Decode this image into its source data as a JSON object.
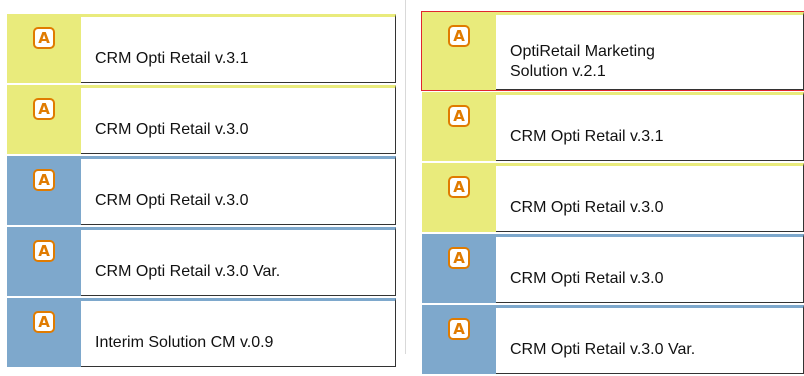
{
  "left_column": [
    {
      "label": "CRM Opti Retail v.3.1",
      "color": "yellow",
      "icon": "app-a-icon"
    },
    {
      "label": "CRM Opti Retail v.3.0",
      "color": "yellow",
      "icon": "app-a-icon"
    },
    {
      "label": "CRM Opti Retail v.3.0",
      "color": "blue",
      "icon": "app-a-icon"
    },
    {
      "label": "CRM Opti Retail v.3.0 Var.",
      "color": "blue",
      "icon": "app-a-icon"
    },
    {
      "label": "Interim Solution CM v.0.9",
      "color": "blue",
      "icon": "app-a-icon"
    }
  ],
  "right_column": [
    {
      "label_line1": "OptiRetail Marketing",
      "label_line2": "Solution v.2.1",
      "color": "yellow",
      "icon": "app-a-icon",
      "selected": true
    },
    {
      "label": "CRM Opti Retail v.3.1",
      "color": "yellow",
      "icon": "app-a-icon"
    },
    {
      "label": "CRM Opti Retail v.3.0",
      "color": "yellow",
      "icon": "app-a-icon"
    },
    {
      "label": "CRM Opti Retail v.3.0",
      "color": "blue",
      "icon": "app-a-icon"
    },
    {
      "label": "CRM Opti Retail v.3.0 Var.",
      "color": "blue",
      "icon": "app-a-icon"
    }
  ],
  "icon_glyph": "A",
  "colors": {
    "yellow": "#e9eb7c",
    "blue": "#7ea8cc",
    "icon_orange": "#e07b00",
    "selection_red": "#e0262e"
  }
}
